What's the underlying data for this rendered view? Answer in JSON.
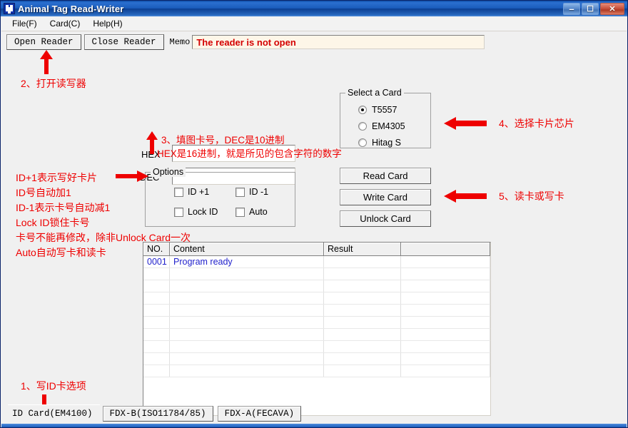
{
  "window": {
    "title": "Animal Tag Read-Writer",
    "icon": "app-icon",
    "buttons": {
      "minimize": "–",
      "maximize": "☐",
      "close": "✕"
    }
  },
  "menu": {
    "items": [
      {
        "label": "File(F)",
        "name": "menu-file"
      },
      {
        "label": "Card(C)",
        "name": "menu-card"
      },
      {
        "label": "Help(H)",
        "name": "menu-help"
      }
    ]
  },
  "toolbar": {
    "open_reader_label": "Open Reader",
    "close_reader_label": "Close Reader",
    "memo_label": "Memo",
    "memo_value": "The reader is not open",
    "memo_color": "#d40000"
  },
  "form": {
    "hex_label": "HEX",
    "hex_value": "",
    "dec_label": "DEC",
    "dec_value": ""
  },
  "select_card": {
    "title": "Select a Card",
    "options": [
      {
        "label": "T5557",
        "checked": true
      },
      {
        "label": "EM4305",
        "checked": false
      },
      {
        "label": "Hitag S",
        "checked": false
      }
    ]
  },
  "options": {
    "title": "Options",
    "items": [
      {
        "label": "ID +1",
        "checked": false
      },
      {
        "label": "ID -1",
        "checked": false
      },
      {
        "label": "Lock ID",
        "checked": false
      },
      {
        "label": "Auto",
        "checked": false
      }
    ]
  },
  "actions": {
    "read_card": "Read Card",
    "write_card": "Write Card",
    "unlock_card": "Unlock Card"
  },
  "grid": {
    "columns": [
      "NO.",
      "Content",
      "Result",
      ""
    ],
    "rows": [
      [
        "0001",
        "Program ready",
        "",
        ""
      ]
    ],
    "empty_row_count": 9,
    "text_color": "#2222cc"
  },
  "tabs": [
    {
      "label": "ID Card(EM4100)",
      "active": true
    },
    {
      "label": "FDX-B(ISO11784/85)",
      "active": false
    },
    {
      "label": "FDX-A(FECAVA)",
      "active": false
    }
  ],
  "annotations": {
    "color": "#ee0000",
    "step1": "1、写ID卡选项",
    "step2": "2、打开读写器",
    "step3_line1": "3、填图卡号，DEC是10进制",
    "step3_line2": "HEX是16进制，就是所见的包含字符的数字",
    "step4": "4、选择卡片芯片",
    "step5": "5、读卡或写卡",
    "options_note_line1": "ID+1表示写好卡片",
    "options_note_line2": "ID号自动加1",
    "options_note_line3": "ID-1表示卡号自动减1",
    "options_note_line4": "Lock ID锁住卡号",
    "options_note_line5": "卡号不能再修改，除非Unlock Card一次",
    "options_note_line6": "Auto自动写卡和读卡"
  }
}
